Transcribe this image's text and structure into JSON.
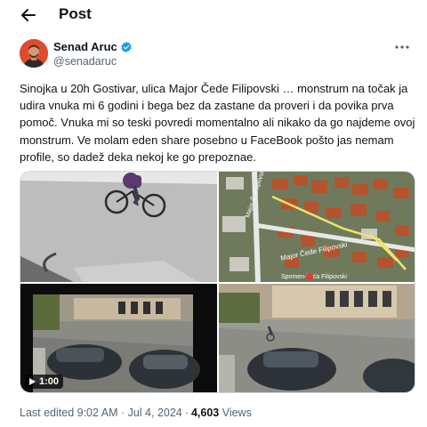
{
  "header": {
    "title": "Post",
    "back_icon": "arrow-left-icon"
  },
  "author": {
    "name": "Senad Aruc",
    "handle": "@senadaruc",
    "verified": true,
    "verified_color": "#1d9bf0",
    "more_icon": "more-horizontal-icon"
  },
  "tweet": {
    "text": "Sinojka u 20h Gostivar, ulica Major Čede Filipovski … monstrum na točak ja udira vnuka mi 6 godini i bega bez da zastane da proveri i da povika prva pomoč. Vnuka mi so teski povredi momentalno ali nikako da go najdeme ovoj monstrum. Ve molam eden share posebno u FaceBook pošto jas nemam profile, so dadež deka nekoj ke go prepoznae."
  },
  "media": {
    "map_label_street": "Major Čede Filipovski",
    "map_label_street_vertical": "Major Č. Filipovski",
    "map_label_place": "Spomen-kuća Filipovski",
    "video_duration": "1:00"
  },
  "meta": {
    "edited": "Last edited 9:02 AM · Jul 4, 2024",
    "views_count": "4,603",
    "views_label": "Views"
  },
  "colors": {
    "text": "#0f1419",
    "secondary": "#536471",
    "accent": "#1d9bf0",
    "border": "#cfd9de"
  }
}
